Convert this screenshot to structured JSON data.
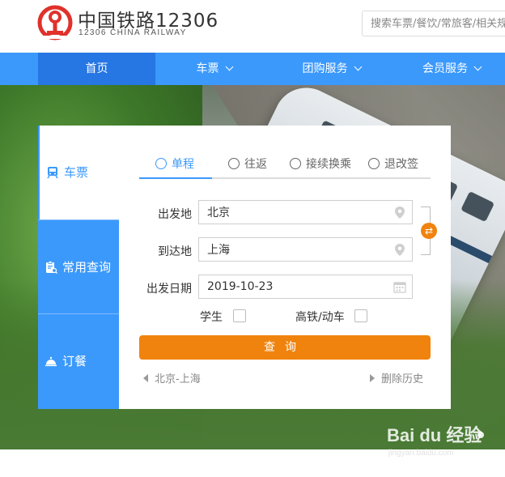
{
  "header": {
    "logo_cn": "中国铁路12306",
    "logo_en": "12306 CHINA RAILWAY",
    "search_placeholder": "搜索车票/餐饮/常旅客/相关规章"
  },
  "nav": {
    "items": [
      {
        "label": "首页",
        "active": true
      },
      {
        "label": "车票",
        "dropdown": true
      },
      {
        "label": "团购服务",
        "dropdown": true
      },
      {
        "label": "会员服务",
        "dropdown": true
      }
    ]
  },
  "side_tabs": [
    {
      "label": "车票",
      "icon": "train-icon",
      "active": true
    },
    {
      "label": "常用查询",
      "icon": "clipboard-search-icon"
    },
    {
      "label": "订餐",
      "icon": "meal-bell-icon"
    }
  ],
  "panel": {
    "tabs": [
      {
        "label": "单程",
        "active": true
      },
      {
        "label": "往返"
      },
      {
        "label": "接续换乘"
      },
      {
        "label": "退改签"
      }
    ],
    "from_label": "出发地",
    "from_value": "北京",
    "to_label": "到达地",
    "to_value": "上海",
    "date_label": "出发日期",
    "date_value": "2019-10-23",
    "student_label": "学生",
    "high_speed_label": "高铁/动车",
    "query_label": "查询",
    "history_route": "北京-上海",
    "clear_history_label": "删除历史"
  },
  "watermark": {
    "line1": "Bai du 经验",
    "line2": "jingyan.baidu.com"
  },
  "colors": {
    "brand_blue": "#3b99fc",
    "nav_active": "#2676e3",
    "accent_orange": "#f0830e",
    "logo_red": "#e0312b"
  }
}
